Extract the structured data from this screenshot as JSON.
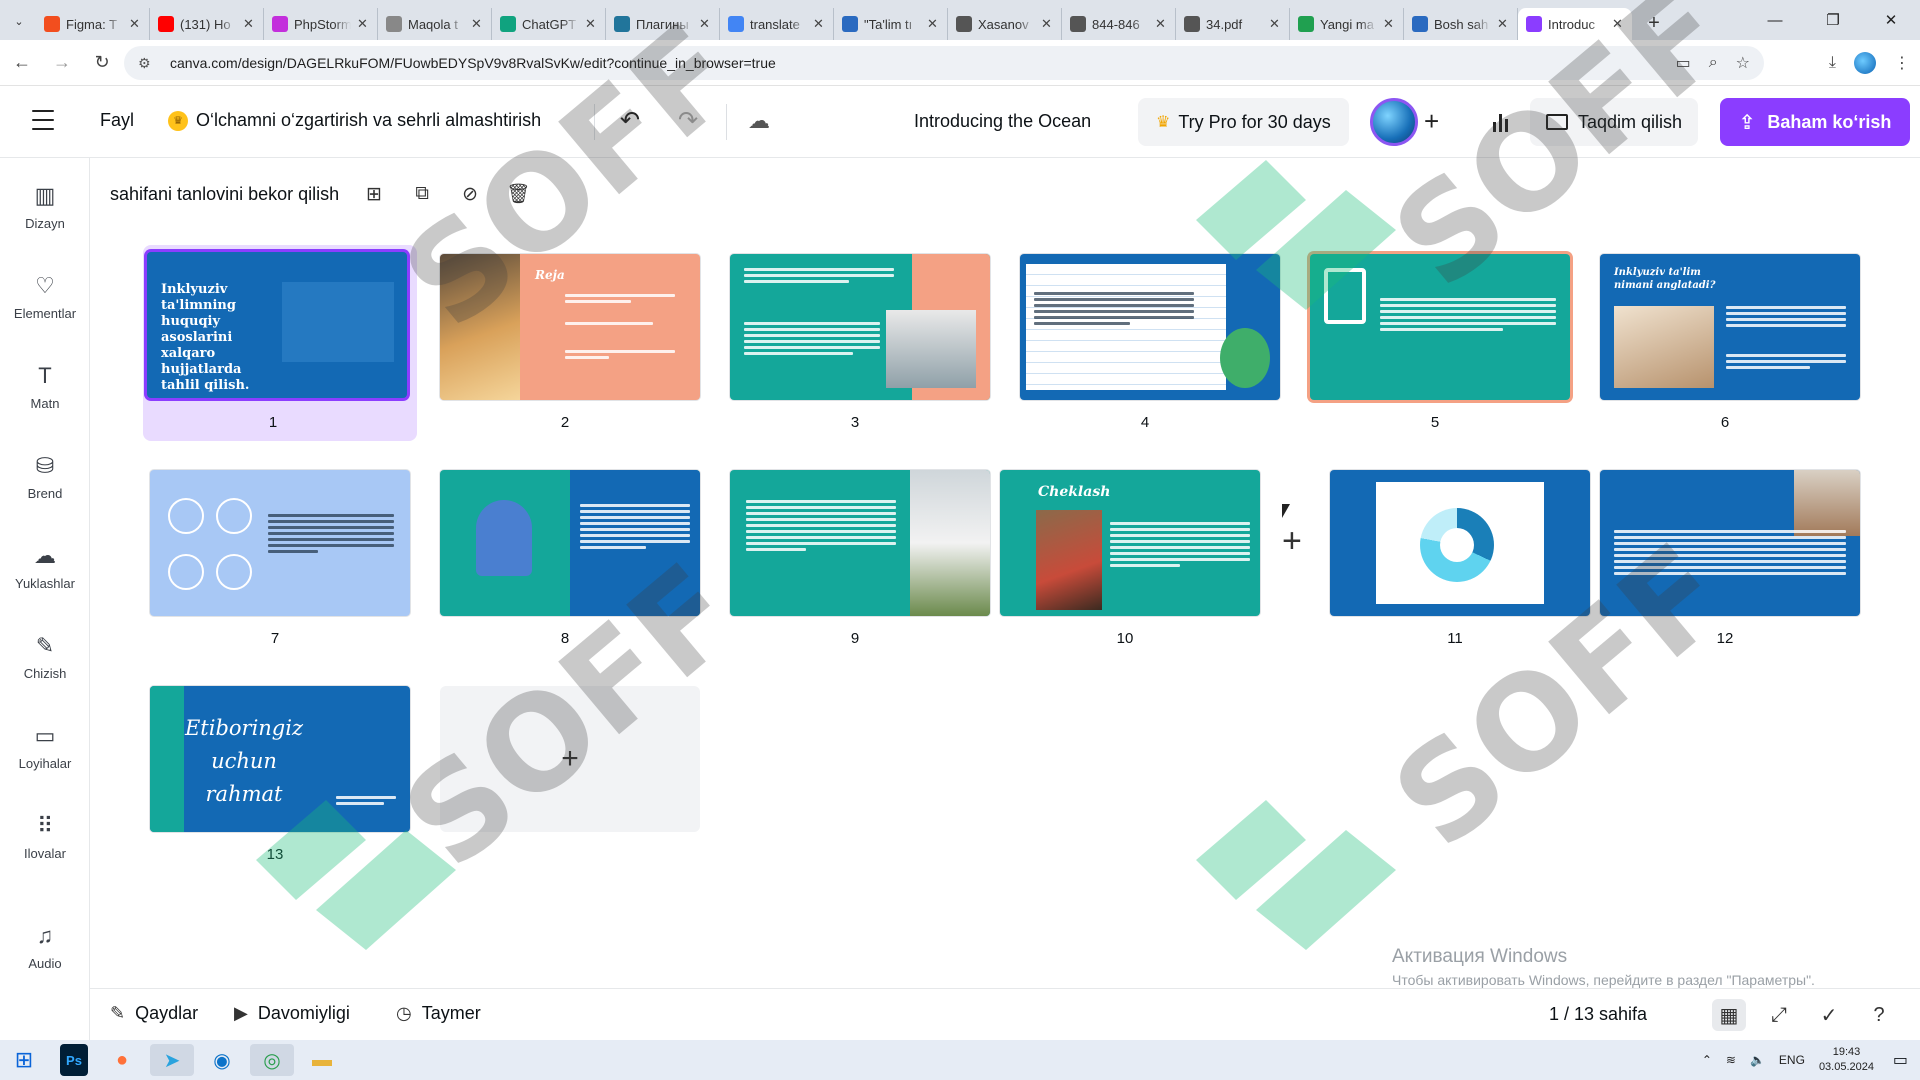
{
  "browser": {
    "tabs": [
      {
        "title": "Figma: T",
        "color": "#f24e1e"
      },
      {
        "title": "(131) Ho",
        "color": "#ff0000"
      },
      {
        "title": "PhpStorm",
        "color": "#c32fdc"
      },
      {
        "title": "Maqola t",
        "color": "#888888"
      },
      {
        "title": "ChatGPT",
        "color": "#10a37f"
      },
      {
        "title": "Плагины",
        "color": "#21759b"
      },
      {
        "title": "translate",
        "color": "#4285f4"
      },
      {
        "title": "\"Ta'lim tı",
        "color": "#2a6ac0"
      },
      {
        "title": "Xasanov",
        "color": "#555555"
      },
      {
        "title": "844-846",
        "color": "#555555"
      },
      {
        "title": "34.pdf",
        "color": "#555555"
      },
      {
        "title": "Yangi ma",
        "color": "#20a050"
      },
      {
        "title": "Bosh sah",
        "color": "#2a6ac0"
      },
      {
        "title": "Introduc",
        "color": "#8b3dff"
      }
    ],
    "url": "canva.com/design/DAGELRkuFOM/FUowbEDYSpV9v8RvalSvKw/edit?continue_in_browser=true"
  },
  "header": {
    "file_label": "Fayl",
    "magic_label": "O‘lchamni o‘zgartirish va sehrli almashtirish",
    "doc_title": "Introducing the Ocean",
    "try_pro_label": "Try Pro for 30 days",
    "present_label": "Taqdim qilish",
    "share_label": "Baham ko‘rish"
  },
  "sidebar": {
    "items": [
      {
        "label": "Dizayn",
        "icon": "design-icon"
      },
      {
        "label": "Elementlar",
        "icon": "elements-icon"
      },
      {
        "label": "Matn",
        "icon": "text-icon"
      },
      {
        "label": "Brend",
        "icon": "brand-icon"
      },
      {
        "label": "Yuklashlar",
        "icon": "upload-icon"
      },
      {
        "label": "Chizish",
        "icon": "draw-icon"
      },
      {
        "label": "Loyihalar",
        "icon": "folder-icon"
      },
      {
        "label": "Ilovalar",
        "icon": "apps-icon"
      },
      {
        "label": "Audio",
        "icon": "music-icon"
      }
    ]
  },
  "toolbar": {
    "deselect_label": "sahifani tanlovini bekor qilish"
  },
  "slides": {
    "numbers": [
      "1",
      "2",
      "3",
      "4",
      "5",
      "6",
      "7",
      "8",
      "9",
      "10",
      "11",
      "12",
      "13"
    ],
    "s1_title": "Inklyuziv ta'limning huquqiy asoslarini xalqaro hujjatlarda tahlil qilish.",
    "s2_title": "Reja",
    "s10_title": "Cheklash",
    "s6_title": "Inklyuziv ta'lim nimani anglatadi?",
    "s13_title": "Etiboringiz uchun rahmat"
  },
  "watermark": {
    "text": "SOFF",
    "activation_title": "Активация Windows",
    "activation_sub": "Чтобы активировать Windows, перейдите в раздел \"Параметры\"."
  },
  "footer": {
    "notes_label": "Qaydlar",
    "duration_label": "Davomiyligi",
    "timer_label": "Taymer",
    "page_indicator": "1 / 13 sahifa"
  },
  "taskbar": {
    "lang": "ENG",
    "time": "19:43",
    "date": "03.05.2024"
  },
  "colors": {
    "accent": "#8b3dff",
    "slide_blue": "#1369b4",
    "slide_teal": "#14a79a",
    "slide_salmon": "#f4a184"
  }
}
